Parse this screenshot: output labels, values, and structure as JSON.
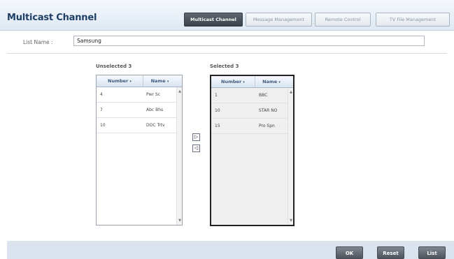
{
  "header": {
    "title": "Multicast Channel",
    "tabs": [
      {
        "label": "Multicast Channel",
        "active": true
      },
      {
        "label": "Message Management",
        "active": false
      },
      {
        "label": "Remote Control",
        "active": false
      },
      {
        "label": "TV File Management",
        "active": false
      }
    ]
  },
  "form": {
    "list_name_label": "List Name :",
    "list_name_value": "Samsung"
  },
  "unselected": {
    "caption": "Unselected 3",
    "columns": [
      "Number",
      "Name"
    ],
    "sort_glyph": "▾",
    "rows": [
      {
        "number": "4",
        "name": "Pwr Sc"
      },
      {
        "number": "7",
        "name": "Abc Bhs"
      },
      {
        "number": "10",
        "name": "DOC Trtv"
      }
    ]
  },
  "selected": {
    "caption": "Selected 3",
    "columns": [
      "Number",
      "Name"
    ],
    "sort_glyph": "▾",
    "rows": [
      {
        "number": "1",
        "name": "BBC"
      },
      {
        "number": "10",
        "name": "STAR NO"
      },
      {
        "number": "15",
        "name": "Pro Spn"
      }
    ]
  },
  "move": {
    "add_glyph": "▷",
    "remove_glyph": "◁"
  },
  "scrollbar": {
    "up": "▲",
    "down": "▼"
  },
  "footer": {
    "ok": "OK",
    "reset": "Reset",
    "list": "List"
  },
  "colors": {
    "header_title": "#1f3e66",
    "active_tab": "#3b424b",
    "footer": "#dbe3ee"
  }
}
